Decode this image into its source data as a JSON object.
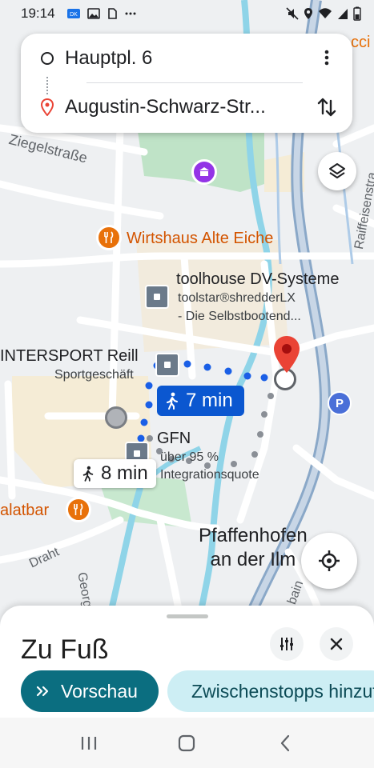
{
  "status_bar": {
    "time": "19:14",
    "icons_left": [
      "dk-icon",
      "image-icon",
      "app-icon",
      "more-dots"
    ],
    "icons_right": [
      "mute-icon",
      "location-icon",
      "wifi-icon",
      "signal-icon",
      "battery-icon"
    ]
  },
  "route": {
    "origin": "Hauptpl. 6",
    "destination": "Augustin-Schwarz-Str..."
  },
  "map": {
    "labels": {
      "ziegelstrasse": "Ziegelstraße",
      "wirtshaus": "Wirtshaus Alte Eiche",
      "toolhouse_title": "toolhouse DV-Systeme",
      "toolhouse_line2": "toolstar®shredderLX",
      "toolhouse_line3": "- Die Selbstbootend...",
      "intersport": "INTERSPORT Reill",
      "intersport_sub": "Sportgeschäft",
      "gfn": "GFN",
      "gfn_line2": "über 95 %",
      "gfn_line3": "Integrationsquote",
      "salatbar": "alatbar",
      "town_line1": "Pfaffenhofen",
      "town_line2": "an der Ilm",
      "raiffeisen": "Raiffeisenstra",
      "draht": "Draht",
      "georg": "Georg",
      "bain": "bain",
      "parking": "P",
      "cci": "cci"
    },
    "route_badges": {
      "primary": "7 min",
      "alternative": "8 min"
    },
    "colors": {
      "route": "#1a5fe6",
      "badge": "#0b57d0",
      "water": "#8fd4e8",
      "park": "#bfe3c7",
      "road": "#ffffff",
      "major_road": "#8aa8c8",
      "poi_orange": "#e8710a",
      "pin_red": "#ea4335"
    }
  },
  "sheet": {
    "title": "Zu Fuß",
    "preview_label": "Vorschau",
    "stops_label": "Zwischenstopps hinzufügen"
  }
}
